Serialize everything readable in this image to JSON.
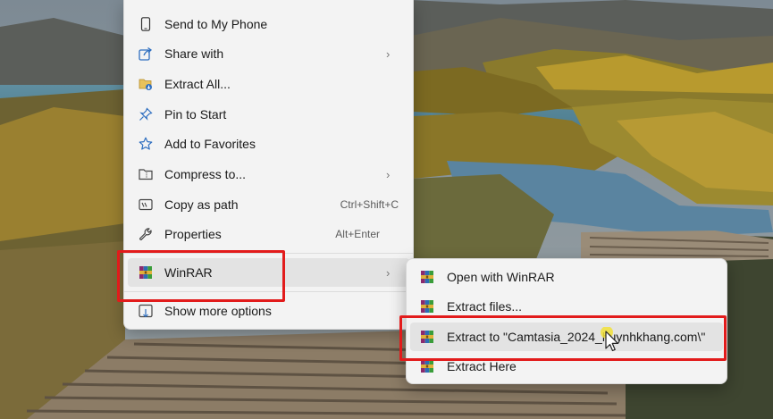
{
  "context_menu": {
    "items": [
      {
        "label": "Send to My Phone",
        "icon": "phone-icon"
      },
      {
        "label": "Share with",
        "icon": "share-icon",
        "submenu": true
      },
      {
        "label": "Extract All...",
        "icon": "extract-all-icon"
      },
      {
        "label": "Pin to Start",
        "icon": "pin-icon"
      },
      {
        "label": "Add to Favorites",
        "icon": "star-icon"
      },
      {
        "label": "Compress to...",
        "icon": "folder-zip-icon",
        "submenu": true
      },
      {
        "label": "Copy as path",
        "icon": "copy-path-icon",
        "shortcut": "Ctrl+Shift+C"
      },
      {
        "label": "Properties",
        "icon": "wrench-icon",
        "shortcut": "Alt+Enter"
      },
      {
        "label": "WinRAR",
        "icon": "winrar-icon",
        "submenu": true
      },
      {
        "label": "Show more options",
        "icon": "more-options-icon"
      }
    ]
  },
  "winrar_submenu": {
    "items": [
      {
        "label": "Open with WinRAR",
        "icon": "winrar-icon"
      },
      {
        "label": "Extract files...",
        "icon": "winrar-icon"
      },
      {
        "label": "Extract to \"Camtasia_2024_huynhkhang.com\\\"",
        "icon": "winrar-icon"
      },
      {
        "label": "Extract Here",
        "icon": "winrar-icon"
      }
    ]
  },
  "colors": {
    "highlight_border": "#e21b1b",
    "menu_bg": "#f3f3f3",
    "hover_bg": "#e3e3e3"
  }
}
